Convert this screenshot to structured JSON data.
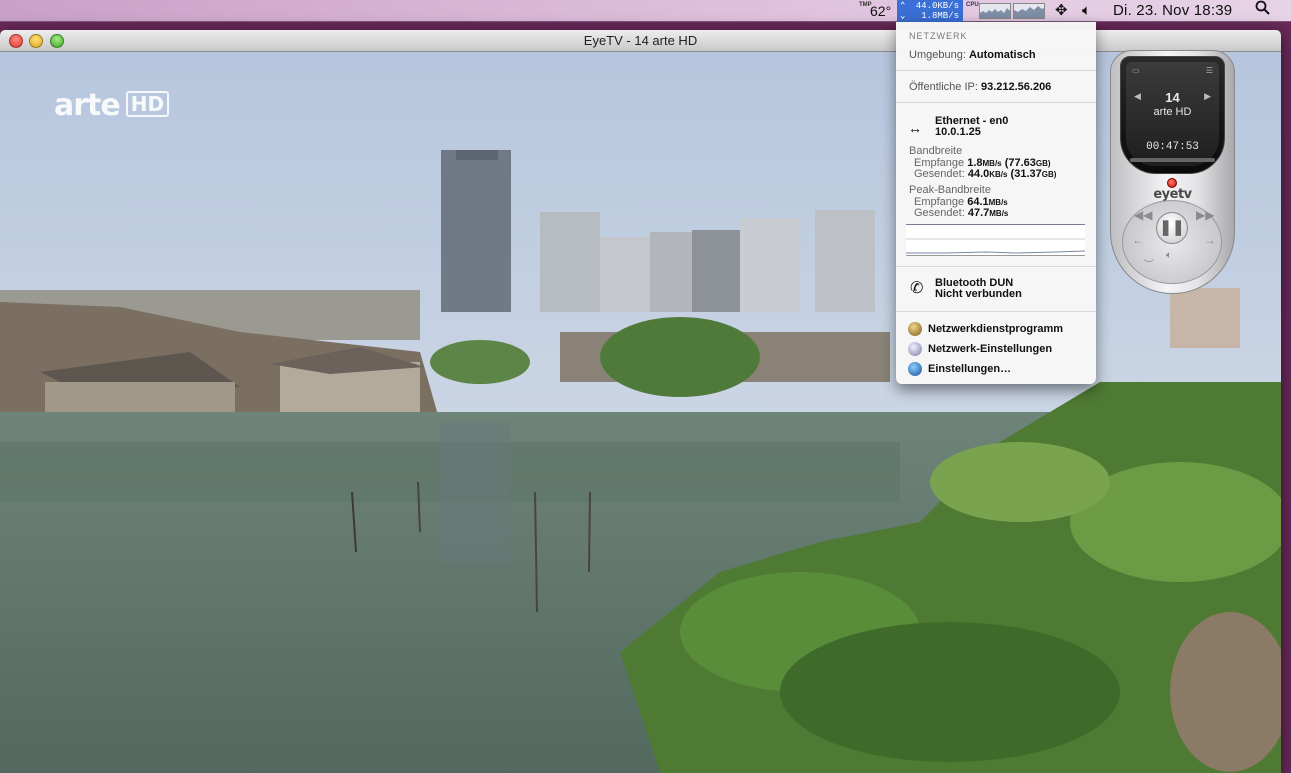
{
  "menubar": {
    "tmp_label": "TMP",
    "temperature": "62°",
    "net_up": "44.0KB/s",
    "net_down": "1.8MB/s",
    "cpu_label": "CPU",
    "clock": "Di. 23. Nov  18:39"
  },
  "window": {
    "title": "EyeTV - 14 arte HD"
  },
  "channel_logo": {
    "text": "arte",
    "hd": "HD"
  },
  "network_menu": {
    "header": "NETZWERK",
    "environment_label": "Umgebung:",
    "environment_value": "Automatisch",
    "public_ip_label": "Öffentliche IP:",
    "public_ip_value": "93.212.56.206",
    "ethernet": {
      "name": "Ethernet - en0",
      "ip": "10.0.1.25"
    },
    "bandwidth": {
      "title": "Bandbreite",
      "receive_label": "Empfange",
      "receive_value": "1.8",
      "receive_unit": "MB/s",
      "receive_total": "(77.63",
      "receive_total_unit": "GB)",
      "send_label": "Gesendet:",
      "send_value": "44.0",
      "send_unit": "KB/s",
      "send_total": "(31.37",
      "send_total_unit": "GB)"
    },
    "peak": {
      "title": "Peak-Bandbreite",
      "receive_label": "Empfange",
      "receive_value": "64.1",
      "receive_unit": "MB/s",
      "send_label": "Gesendet:",
      "send_value": "47.7",
      "send_unit": "MB/s"
    },
    "bluetooth": {
      "name": "Bluetooth DUN",
      "status": "Nicht verbunden"
    },
    "items": [
      {
        "label": "Netzwerkdienstprogramm"
      },
      {
        "label": "Netzwerk-Einstellungen"
      },
      {
        "label": "Einstellungen…"
      }
    ]
  },
  "remote": {
    "channel_number": "14",
    "channel_name": "arte HD",
    "time": "00:47:53",
    "brand": "eyetv",
    "progress": 0.0
  }
}
